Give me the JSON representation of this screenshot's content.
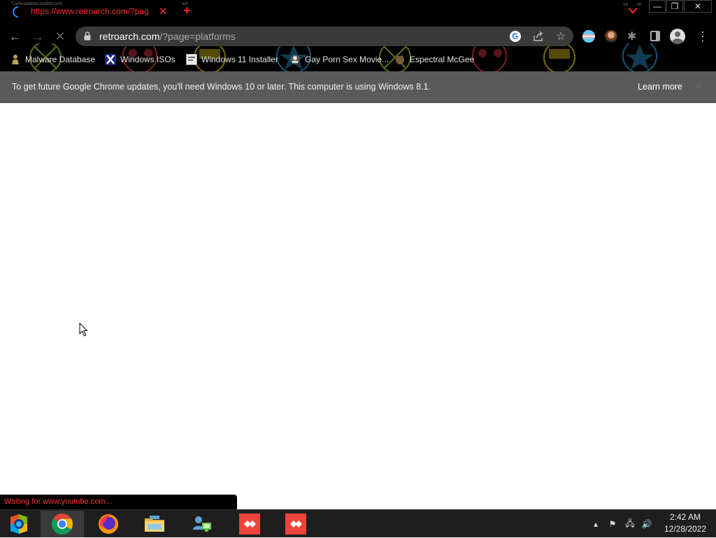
{
  "window": {
    "tab_title": "https://www.retroarch.com/?pag",
    "tab_tiny_url": "©whosammer.tumblr.com",
    "tab_tiny_mark": "wlt",
    "new_tab_glyph": "+",
    "tab_search_tiny": "xlt",
    "tab_search_tiny2": "xlt",
    "minimize_glyph": "—",
    "maximize_glyph": "❐",
    "close_glyph": "✕",
    "tab_close_glyph": "✕"
  },
  "toolbar": {
    "back_glyph": "←",
    "forward_glyph": "→",
    "stop_glyph": "✕",
    "url_host": "retroarch.com",
    "url_path": "/?page=platforms",
    "icons": [
      "lock-icon",
      "google-lens-icon",
      "share-icon",
      "star-icon",
      "trans-flag-extension-icon",
      "avatar-extension-icon",
      "puzzle-extensions-icon",
      "side-panel-icon",
      "profile-icon",
      "kebab-menu-icon"
    ],
    "star_glyph": "☆",
    "puzzle_glyph": "✱",
    "menu_glyph": "⋮"
  },
  "bookmarks": [
    {
      "label": "Malware Database",
      "icon": "warning-person-icon"
    },
    {
      "label": "Windows ISOs",
      "icon": "x-logo-icon"
    },
    {
      "label": "Windows 11 Installer",
      "icon": "installer-icon"
    },
    {
      "label": "Gay Porn Sex Movie...",
      "icon": "site-icon"
    },
    {
      "label": "Espectral McGee",
      "icon": "cat-icon"
    }
  ],
  "infobar": {
    "message": "To get future Google Chrome updates, you'll need Windows 10 or later. This computer is using Windows 8.1.",
    "link": "Learn more",
    "close_glyph": "✕"
  },
  "status": {
    "text": "Waiting for www.youtube.com..."
  },
  "taskbar": {
    "apps": [
      "media-center-icon",
      "chrome-icon",
      "firefox-icon",
      "file-explorer-icon",
      "network-people-icon",
      "anydesk-icon",
      "anydesk-icon"
    ],
    "tray": {
      "chevron_glyph": "▴",
      "flag_glyph": "⚑",
      "network_glyph": "🖧",
      "volume_glyph": "🔊"
    },
    "time": "2:42 AM",
    "date": "12/28/2022"
  },
  "colors": {
    "accent_red": "#ff2a2a",
    "chrome_dark": "#000000",
    "infobar_gray": "#5a5a5a",
    "taskbar": "#1e1e1e"
  }
}
